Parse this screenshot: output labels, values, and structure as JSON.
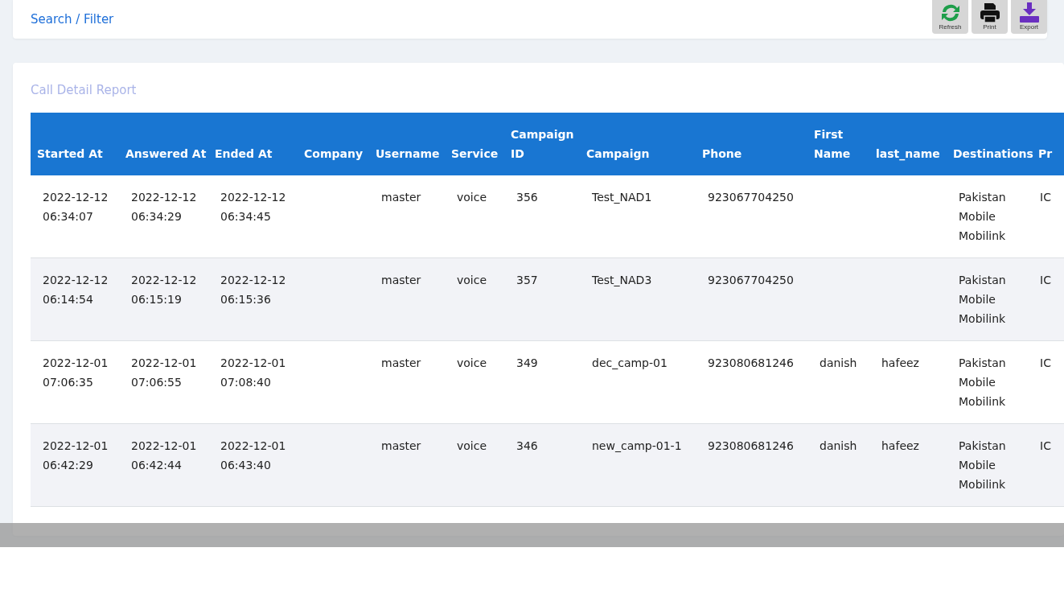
{
  "filter": {
    "link": "Search / Filter"
  },
  "toolbar": [
    {
      "kind": "refresh",
      "label": "Refresh"
    },
    {
      "kind": "print",
      "label": "Print"
    },
    {
      "kind": "export",
      "label": "Export"
    }
  ],
  "report": {
    "title": "Call Detail Report"
  },
  "table": {
    "columns": [
      "Started At",
      "Answered At",
      "Ended At",
      "Company",
      "Username",
      "Service",
      "Campaign ID",
      "Campaign",
      "Phone",
      "First Name",
      "last_name",
      "Destinations",
      "Pr"
    ],
    "rows": [
      [
        "2022-12-12 06:34:07",
        "2022-12-12 06:34:29",
        "2022-12-12 06:34:45",
        "",
        "master",
        "voice",
        "356",
        "Test_NAD1",
        "923067704250",
        "",
        "",
        "Pakistan Mobile Mobilink",
        "IC"
      ],
      [
        "2022-12-12 06:14:54",
        "2022-12-12 06:15:19",
        "2022-12-12 06:15:36",
        "",
        "master",
        "voice",
        "357",
        "Test_NAD3",
        "923067704250",
        "",
        "",
        "Pakistan Mobile Mobilink",
        "IC"
      ],
      [
        "2022-12-01 07:06:35",
        "2022-12-01 07:06:55",
        "2022-12-01 07:08:40",
        "",
        "master",
        "voice",
        "349",
        "dec_camp-01",
        "923080681246",
        "danish",
        "hafeez",
        "Pakistan Mobile Mobilink",
        "IC"
      ],
      [
        "2022-12-01 06:42:29",
        "2022-12-01 06:42:44",
        "2022-12-01 06:43:40",
        "",
        "master",
        "voice",
        "346",
        "new_camp-01-1",
        "923080681246",
        "danish",
        "hafeez",
        "Pakistan Mobile Mobilink",
        "IC"
      ]
    ]
  }
}
